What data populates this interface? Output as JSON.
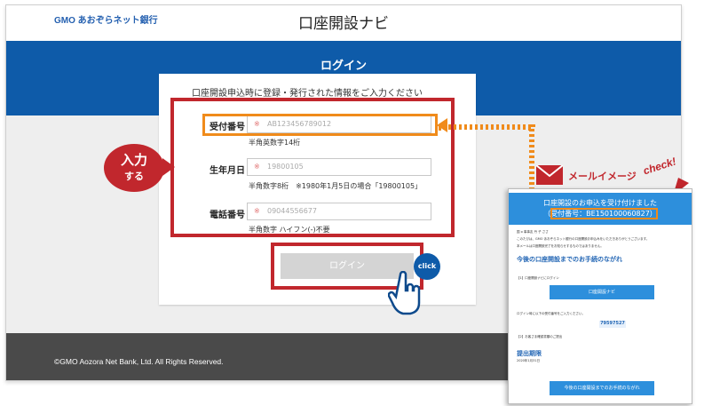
{
  "app": {
    "logo": "GMO あおぞらネット銀行",
    "title": "口座開設ナビ"
  },
  "login": {
    "heading": "ログイン",
    "intro": "口座開設申込時に登録・発行された情報をご入力ください",
    "fields": [
      {
        "label": "受付番号",
        "required_mark": "※",
        "placeholder": "AB123456789012",
        "hint": "半角英数字14桁"
      },
      {
        "label": "生年月日",
        "required_mark": "※",
        "placeholder": "19800105",
        "hint": "半角数字8桁　※1980年1月5日の場合「19800105」"
      },
      {
        "label": "電話番号",
        "required_mark": "※",
        "placeholder": "09044556677",
        "hint": "半角数字 ハイフン(-)不要"
      }
    ],
    "button": "ログイン",
    "footer": "©GMO Aozora Net Bank, Ltd. All Rights Reserved."
  },
  "annotations": {
    "badge_line1": "入力",
    "badge_line2": "する",
    "click": "click",
    "mail": "メールイメージ",
    "check": "check!"
  },
  "email": {
    "header_line1": "口座開設のお申込を受け付けました",
    "header_line2": "（受付番号：BE150100060827）",
    "greeting": "国 o 事事友 丹 子 ささ",
    "body1": "このたびは、GMO あおぞらネット銀行の口座開設お申込みをいただきありがとうございます。",
    "body2": "本メールは口座開設完了をお知らせするものではありません。",
    "section1": "今後の口座開設までのお手続のながれ",
    "step1": "【1】口座開設ナビにログイン",
    "btn1": "口座開設ナビ",
    "step_note": "ログイン時に以下の受付番号をご入力ください。",
    "code": "79597527",
    "step2": "【2】お客さま確認書類のご提出",
    "section2": "提出期限",
    "deadline": "2020年1月31日",
    "btn2": "今後の口座開設までのお手続のながれ",
    "colors": {
      "brand_blue": "#0e5ba9",
      "accent_red": "#c1272d",
      "accent_orange": "#f08b1b"
    }
  }
}
